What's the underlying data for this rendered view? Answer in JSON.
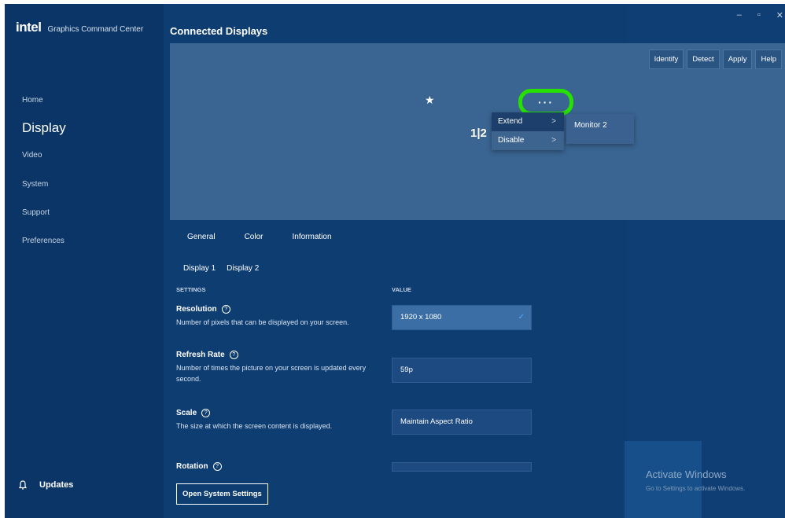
{
  "brand": {
    "logo": "intel",
    "app_name": "Graphics Command Center"
  },
  "window_controls": {
    "minimize": "–",
    "maximize": "▫",
    "close": "✕"
  },
  "sidebar": {
    "items": [
      {
        "label": "Home"
      },
      {
        "label": "Display",
        "active": true
      },
      {
        "label": "Video"
      },
      {
        "label": "System"
      },
      {
        "label": "Support"
      },
      {
        "label": "Preferences"
      }
    ],
    "updates_label": "Updates"
  },
  "page_title": "Connected Displays",
  "toolbar": {
    "identify": "Identify",
    "detect": "Detect",
    "apply": "Apply",
    "help": "Help"
  },
  "preview": {
    "star_glyph": "★",
    "monitor_label": "1|2",
    "more_glyph": "···",
    "menu": [
      {
        "label": "Extend",
        "chevron": ">"
      },
      {
        "label": "Disable",
        "chevron": ">"
      }
    ],
    "submenu": [
      "Monitor 2"
    ]
  },
  "tabs": [
    "General",
    "Color",
    "Information"
  ],
  "display_tabs": [
    "Display 1",
    "Display 2"
  ],
  "table_headers": {
    "settings": "SETTINGS",
    "value": "VALUE"
  },
  "settings": [
    {
      "title": "Resolution",
      "desc": "Number of pixels that can be displayed on your screen.",
      "value": "1920 x 1080"
    },
    {
      "title": "Refresh Rate",
      "desc": "Number of times the picture on your screen is updated every second.",
      "value": "59p"
    },
    {
      "title": "Scale",
      "desc": "The size at which the screen content is displayed.",
      "value": "Maintain Aspect Ratio"
    },
    {
      "title": "Rotation",
      "desc": "",
      "value": ""
    }
  ],
  "open_settings_button": "Open System Settings",
  "watermark": {
    "title": "Activate Windows",
    "subtitle": "Go to Settings to activate Windows."
  },
  "colors": {
    "highlight_ring": "#26e000",
    "background": "#0d3a6e",
    "panel": "#3a6592"
  }
}
